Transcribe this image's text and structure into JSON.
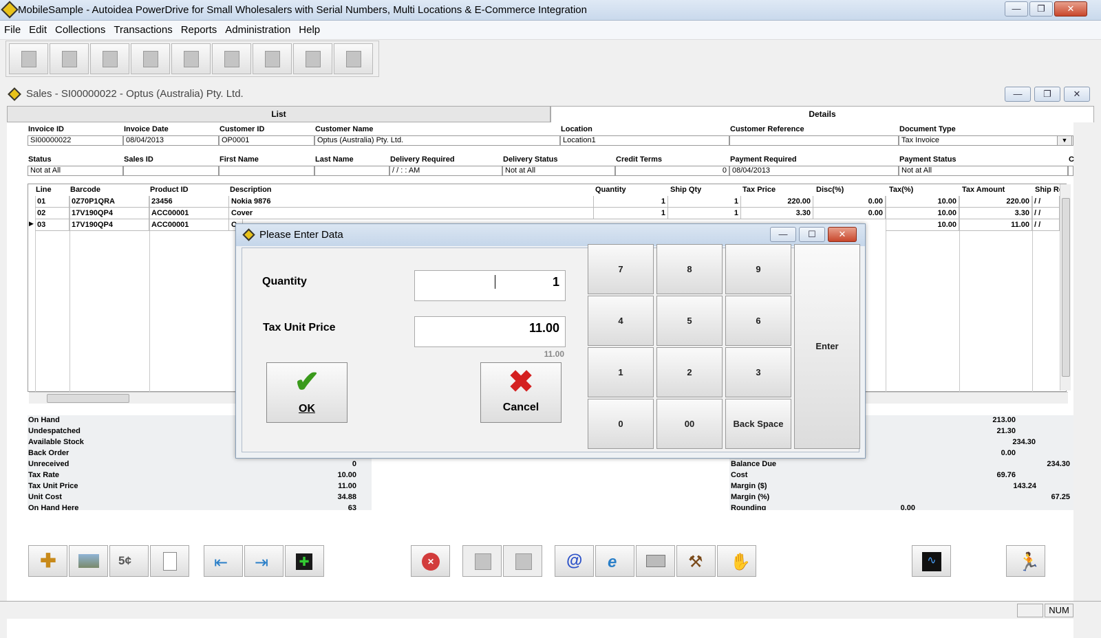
{
  "app": {
    "title": "MobileSample - Autoidea PowerDrive for Small Wholesalers with Serial Numbers, Multi Locations & E-Commerce Integration"
  },
  "menu": [
    "File",
    "Edit",
    "Collections",
    "Transactions",
    "Reports",
    "Administration",
    "Help"
  ],
  "sales_window": {
    "title": "Sales - SI00000022 - Optus (Australia) Pty. Ltd.",
    "tabs": {
      "list": "List",
      "details": "Details"
    }
  },
  "header1": {
    "labels": [
      "Invoice ID",
      "Invoice Date",
      "Customer ID",
      "Customer Name",
      "Location",
      "Customer Reference",
      "Document Type"
    ],
    "values": [
      "SI00000022",
      "08/04/2013",
      "OP0001",
      "Optus (Australia) Pty. Ltd.",
      "Location1",
      "",
      "Tax Invoice"
    ]
  },
  "header2": {
    "labels": [
      "Status",
      "Sales ID",
      "First Name",
      "Last Name",
      "Delivery Required",
      "Delivery Status",
      "Credit Terms",
      "Payment Required",
      "Payment Status",
      "C"
    ],
    "values": [
      "Not at All",
      "",
      "",
      "",
      "/ /      : :  AM",
      "Not at All",
      "0",
      "08/04/2013",
      "Not at All",
      ""
    ]
  },
  "grid": {
    "columns": [
      "Line",
      "Barcode",
      "Product ID",
      "Description",
      "Quantity",
      "Ship Qty",
      "Tax Price",
      "Disc(%)",
      "Tax(%)",
      "Tax Amount",
      "Ship Re"
    ],
    "rows": [
      [
        "01",
        "0Z70P1QRA",
        "23456",
        "Nokia 9876",
        "1",
        "1",
        "220.00",
        "0.00",
        "10.00",
        "220.00",
        "/ /"
      ],
      [
        "02",
        "17V190QP4",
        "ACC00001",
        "Cover",
        "1",
        "1",
        "3.30",
        "0.00",
        "10.00",
        "3.30",
        "/ /"
      ],
      [
        "03",
        "17V190QP4",
        "ACC00001",
        "C",
        "",
        "",
        "",
        "",
        "10.00",
        "11.00",
        "/ /"
      ]
    ],
    "row_marker": "▶"
  },
  "left_stats": [
    {
      "label": "On Hand",
      "value": ""
    },
    {
      "label": "Undespatched",
      "value": ""
    },
    {
      "label": "Available Stock",
      "value": ""
    },
    {
      "label": "Back Order",
      "value": ""
    },
    {
      "label": "Unreceived",
      "value": "0"
    },
    {
      "label": "Tax Rate",
      "value": "10.00"
    },
    {
      "label": "Tax Unit Price",
      "value": "11.00"
    },
    {
      "label": "Unit Cost",
      "value": "34.88"
    },
    {
      "label": "On Hand Here",
      "value": "63"
    }
  ],
  "right_stats": {
    "partial_values": [
      "213.00",
      "21.30",
      "234.30",
      "0.00"
    ],
    "rows": [
      {
        "label": "Balance Due",
        "value": "234.30"
      },
      {
        "label": "Cost",
        "value": "69.76"
      },
      {
        "label": "Margin ($)",
        "value": "143.24"
      },
      {
        "label": "Margin (%)",
        "value": "67.25"
      },
      {
        "label": "Rounding",
        "value": "0.00"
      }
    ]
  },
  "dialog": {
    "title": "Please Enter Data",
    "quantity_label": "Quantity",
    "quantity_value": "1",
    "price_label": "Tax Unit Price",
    "price_value": "11.00",
    "price_hint": "11.00",
    "ok_label": "OK",
    "cancel_label": "Cancel",
    "keys": [
      "7",
      "8",
      "9",
      "4",
      "5",
      "6",
      "1",
      "2",
      "3",
      "0",
      "00",
      "Back Space"
    ],
    "enter_label": "Enter"
  },
  "bottom_buttons": {
    "coin_label": "5¢"
  },
  "status": {
    "num": "NUM"
  },
  "colors": {
    "ok_green": "#3a9a1c",
    "cancel_red": "#d42020",
    "titlebar": "#c9d9ec"
  }
}
